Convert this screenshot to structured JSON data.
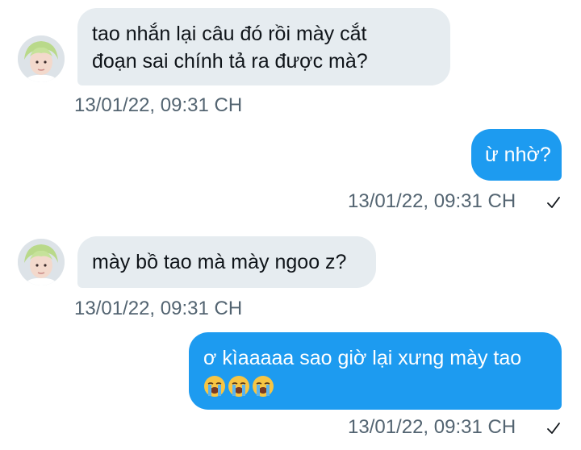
{
  "messages": [
    {
      "direction": "incoming",
      "lines": [
        "tao nhắn lại câu đó rồi mày cắt",
        "đoạn sai chính tả ra được mà?"
      ],
      "timestamp": "13/01/22, 09:31 CH"
    },
    {
      "direction": "outgoing",
      "lines": [
        "ừ nhờ?"
      ],
      "timestamp": "13/01/22, 09:31 CH",
      "status_icon": "check-icon"
    },
    {
      "direction": "incoming",
      "lines": [
        "mày bồ tao mà mày ngoo z?"
      ],
      "timestamp": "13/01/22, 09:31 CH"
    },
    {
      "direction": "outgoing",
      "lines": [
        "ơ kìaaaaa sao giờ lại xưng mày tao"
      ],
      "emojis": [
        "loudly-crying-face",
        "loudly-crying-face",
        "loudly-crying-face"
      ],
      "timestamp": "13/01/22, 09:31 CH",
      "status_icon": "check-icon"
    }
  ],
  "colors": {
    "incoming_bubble": "#e6ecf0",
    "outgoing_bubble": "#1d9bf0",
    "timestamp_text": "#536471",
    "avatar_hair": "#b9d98a"
  }
}
